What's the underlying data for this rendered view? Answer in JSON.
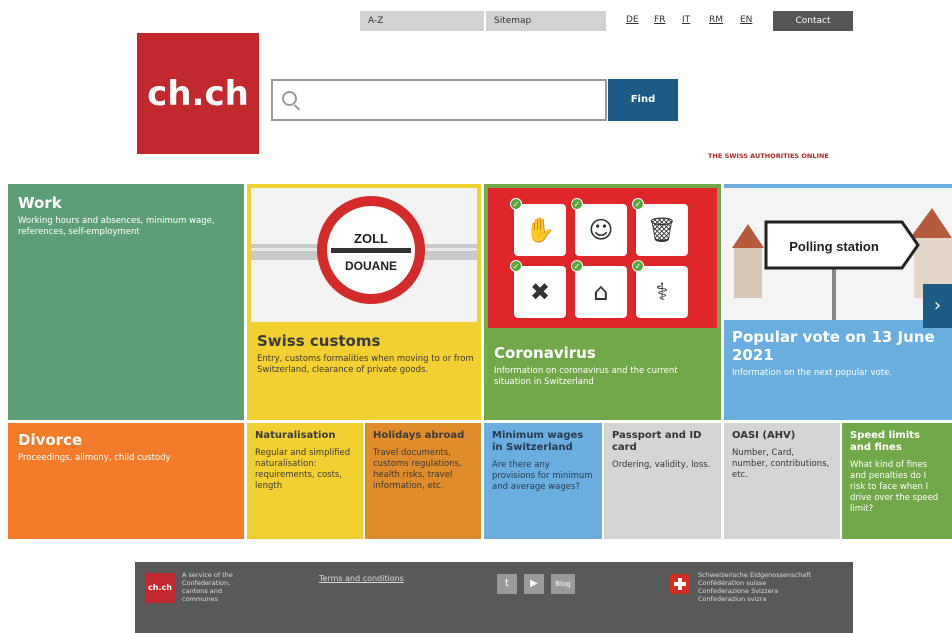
{
  "topnav": {
    "az": "A-Z",
    "sitemap": "Sitemap",
    "languages": [
      "DE",
      "FR",
      "IT",
      "RM",
      "EN"
    ],
    "contact": "Contact"
  },
  "logo": {
    "text": "ch.ch"
  },
  "search": {
    "value": "",
    "placeholder": "",
    "button": "Find"
  },
  "tagline": "THE SWISS AUTHORITIES ONLINE",
  "tiles": {
    "work": {
      "title": "Work",
      "desc": "Working hours and absences, minimum wage, references, self-employment"
    },
    "customs": {
      "title": "Swiss customs",
      "desc": "Entry, customs formalities when moving to or from Switzerland, clearance of private goods.",
      "sign_top": "ZOLL",
      "sign_bottom": "DOUANE"
    },
    "corona": {
      "title": "Coronavirus",
      "desc": "Information on coronavirus and the current situation in Switzerland"
    },
    "vote": {
      "title": "Popular vote on 13 June 2021",
      "desc": "Information on the next popular vote.",
      "sign": "Polling station"
    },
    "divorce": {
      "title": "Divorce",
      "desc": "Proceedings, alimony, child custody"
    },
    "naturalisation": {
      "title": "Naturalisation",
      "desc": "Regular and simplified naturalisation: requirements, costs, length"
    },
    "holidays": {
      "title": "Holidays abroad",
      "desc": "Travel documents, customs regulations, health risks, travel information, etc."
    },
    "minwage": {
      "title": "Minimum wages in Switzerland",
      "desc": "Are there any provisions for minimum and average wages?"
    },
    "passport": {
      "title": "Passport and ID card",
      "desc": "Ordering, validity, loss."
    },
    "oasi": {
      "title": "OASI (AHV)",
      "desc": "Number, Card, number, contributions, etc."
    },
    "speed": {
      "title": "Speed limits and fines",
      "desc": "What kind of fines and penalties do I risk to face when I drive over the speed limit?"
    }
  },
  "footer": {
    "logo": "ch.ch",
    "service": "A service of the Confederation, cantons and communes",
    "terms": "Terms and conditions",
    "blog": "Blog",
    "confederation": [
      "Schweizerische Eidgenossenschaft",
      "Confédération suisse",
      "Confederazione Svizzera",
      "Confederaziun svizra"
    ]
  },
  "colors": {
    "brand_red": "#c1292e",
    "work_green": "#5e9e77",
    "customs_yellow": "#f2d031",
    "corona_green": "#71a84a",
    "vote_blue": "#6aaee0",
    "divorce_orange": "#f27b2a",
    "find_blue": "#1d5b84"
  }
}
